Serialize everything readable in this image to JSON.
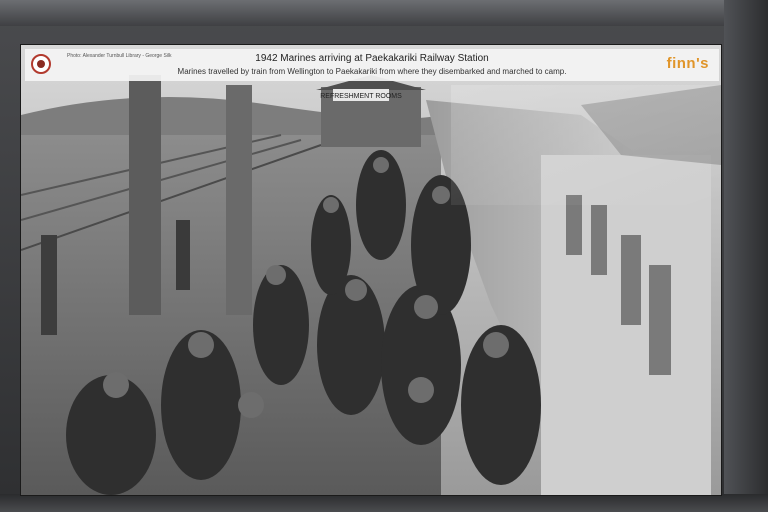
{
  "caption": {
    "credit": "Photo: Alexander Turnbull Library - George Silk",
    "title": "1942  Marines arriving at Paekakariki Railway Station",
    "subtitle": "Marines travelled by train from Wellington to Paekakariki from where they disembarked and marched to camp.",
    "brand": "finn's"
  },
  "photo": {
    "station_sign": "REFRESHMENT ROOMS",
    "subject": "marines-marching-beside-train"
  },
  "colors": {
    "brand": "#e0952a",
    "banner": "#f4f4f4"
  }
}
